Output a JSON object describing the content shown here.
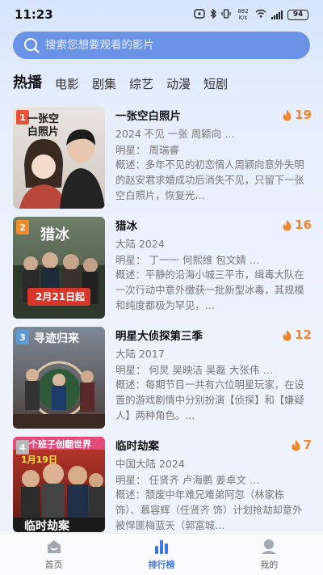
{
  "status": {
    "time": "11:23",
    "network": "882 K/s",
    "battery": "94"
  },
  "search": {
    "placeholder": "搜索您想要观看的影片",
    "icon": "search-icon"
  },
  "tabs": [
    {
      "label": "热播",
      "active": true
    },
    {
      "label": "电影"
    },
    {
      "label": "剧集"
    },
    {
      "label": "综艺"
    },
    {
      "label": "动漫"
    },
    {
      "label": "短剧"
    }
  ],
  "items": [
    {
      "rank": "1",
      "title": "一张空白照片",
      "heat": "19",
      "meta": "2024 不见 一张 周颖向 …",
      "cast": "明星： 周瑞睿",
      "desc": "概述：多年不见的初恋情人周颖向意外失明的赵安君求婚成功后消失不见，只留下一张空白照片，恢复光…",
      "poster_text": "一张空白照片"
    },
    {
      "rank": "2",
      "title": "猎冰",
      "heat": "16",
      "meta": "大陆 2024",
      "cast": "明星： 丁一一  何熙维  包文婧 …",
      "desc": "概述：平静的沿海小城三平市，缉毒大队在一次行动中意外缴获一批新型冰毒，其规模和纯度都极为罕见，…",
      "poster_text": "猎冰",
      "poster_date": "2月21日起"
    },
    {
      "rank": "3",
      "title": "明星大侦探第三季",
      "heat": "12",
      "meta": "大陆 2017",
      "cast": "明星： 何炅  吴映洁  吴磊  大张伟 …",
      "desc": "概述：每期节目一共有六位明星玩家，在设置的游戏剧情中分别扮演【侦探】和【嫌疑人】两种角色。…",
      "poster_text": "寻迹归来"
    },
    {
      "rank": "4",
      "title": "临时劫案",
      "heat": "7",
      "meta": "中国大陆 2024",
      "cast": "明星： 任贤齐  卢海鹏  姜卓文 …",
      "desc": "概述：颓废中年难兄难弟阿忽（林家栋 饰）、慕容辉（任贤齐 饰）计划抢劫却意外被悍匪梅蓝天（郭富城…",
      "poster_text": "临时劫案",
      "poster_top": "个班子创翻世界",
      "poster_date": "1月19日"
    }
  ],
  "nav": [
    {
      "label": "首页",
      "icon": "home-icon"
    },
    {
      "label": "排行榜",
      "icon": "ranking-icon",
      "active": true
    },
    {
      "label": "我的",
      "icon": "profile-icon"
    }
  ],
  "colors": {
    "accent": "#3f77e0",
    "heat": "#f3852a",
    "search_bg": "#6a93e8"
  }
}
